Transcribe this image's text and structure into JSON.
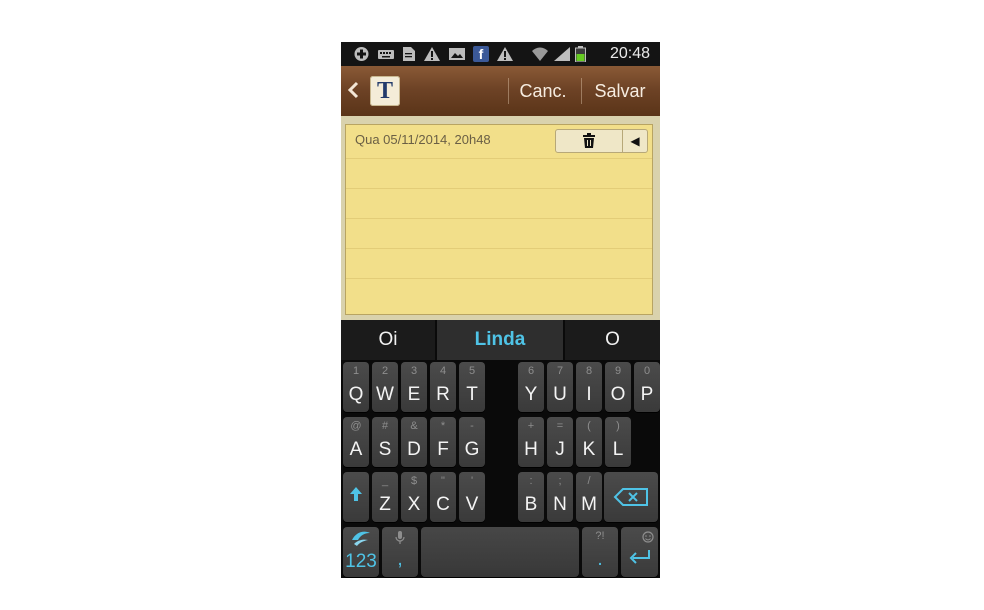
{
  "status_bar": {
    "icons": [
      "plus-icon",
      "keyboard-icon",
      "document-icon",
      "warning-icon",
      "image-icon",
      "facebook-icon",
      "warning-icon",
      "wifi-icon",
      "signal-icon",
      "battery-icon"
    ],
    "facebook_glyph": "f",
    "time": "20:48"
  },
  "action_bar": {
    "logo_letter": "T",
    "cancel_label": "Canc.",
    "save_label": "Salvar"
  },
  "note": {
    "date": "Qua 05/11/2014, 20h48"
  },
  "keyboard": {
    "suggestions": [
      "Oi",
      "Linda",
      "O"
    ],
    "accent_color": "#4fc3e6",
    "rows": [
      {
        "left": [
          {
            "l": "Q",
            "a": "1"
          },
          {
            "l": "W",
            "a": "2"
          },
          {
            "l": "E",
            "a": "3"
          },
          {
            "l": "R",
            "a": "4"
          },
          {
            "l": "T",
            "a": "5"
          }
        ],
        "right": [
          {
            "l": "Y",
            "a": "6"
          },
          {
            "l": "U",
            "a": "7"
          },
          {
            "l": "I",
            "a": "8"
          },
          {
            "l": "O",
            "a": "9"
          },
          {
            "l": "P",
            "a": "0"
          }
        ]
      },
      {
        "left": [
          {
            "l": "A",
            "a": "@"
          },
          {
            "l": "S",
            "a": "#"
          },
          {
            "l": "D",
            "a": "&"
          },
          {
            "l": "F",
            "a": "*"
          },
          {
            "l": "G",
            "a": "-"
          }
        ],
        "right": [
          {
            "l": "H",
            "a": "+"
          },
          {
            "l": "J",
            "a": "="
          },
          {
            "l": "K",
            "a": "("
          },
          {
            "l": "L",
            "a": ")"
          }
        ]
      },
      {
        "left": [
          {
            "l": "Z",
            "a": "_"
          },
          {
            "l": "X",
            "a": "$"
          },
          {
            "l": "C",
            "a": "\""
          },
          {
            "l": "V",
            "a": "'"
          }
        ],
        "right": [
          {
            "l": "B",
            "a": ":"
          },
          {
            "l": "N",
            "a": ";"
          },
          {
            "l": "M",
            "a": "/"
          }
        ]
      }
    ],
    "numbers_label": "123",
    "comma_label": ",",
    "period_label": ".",
    "period_alt": "?!"
  }
}
